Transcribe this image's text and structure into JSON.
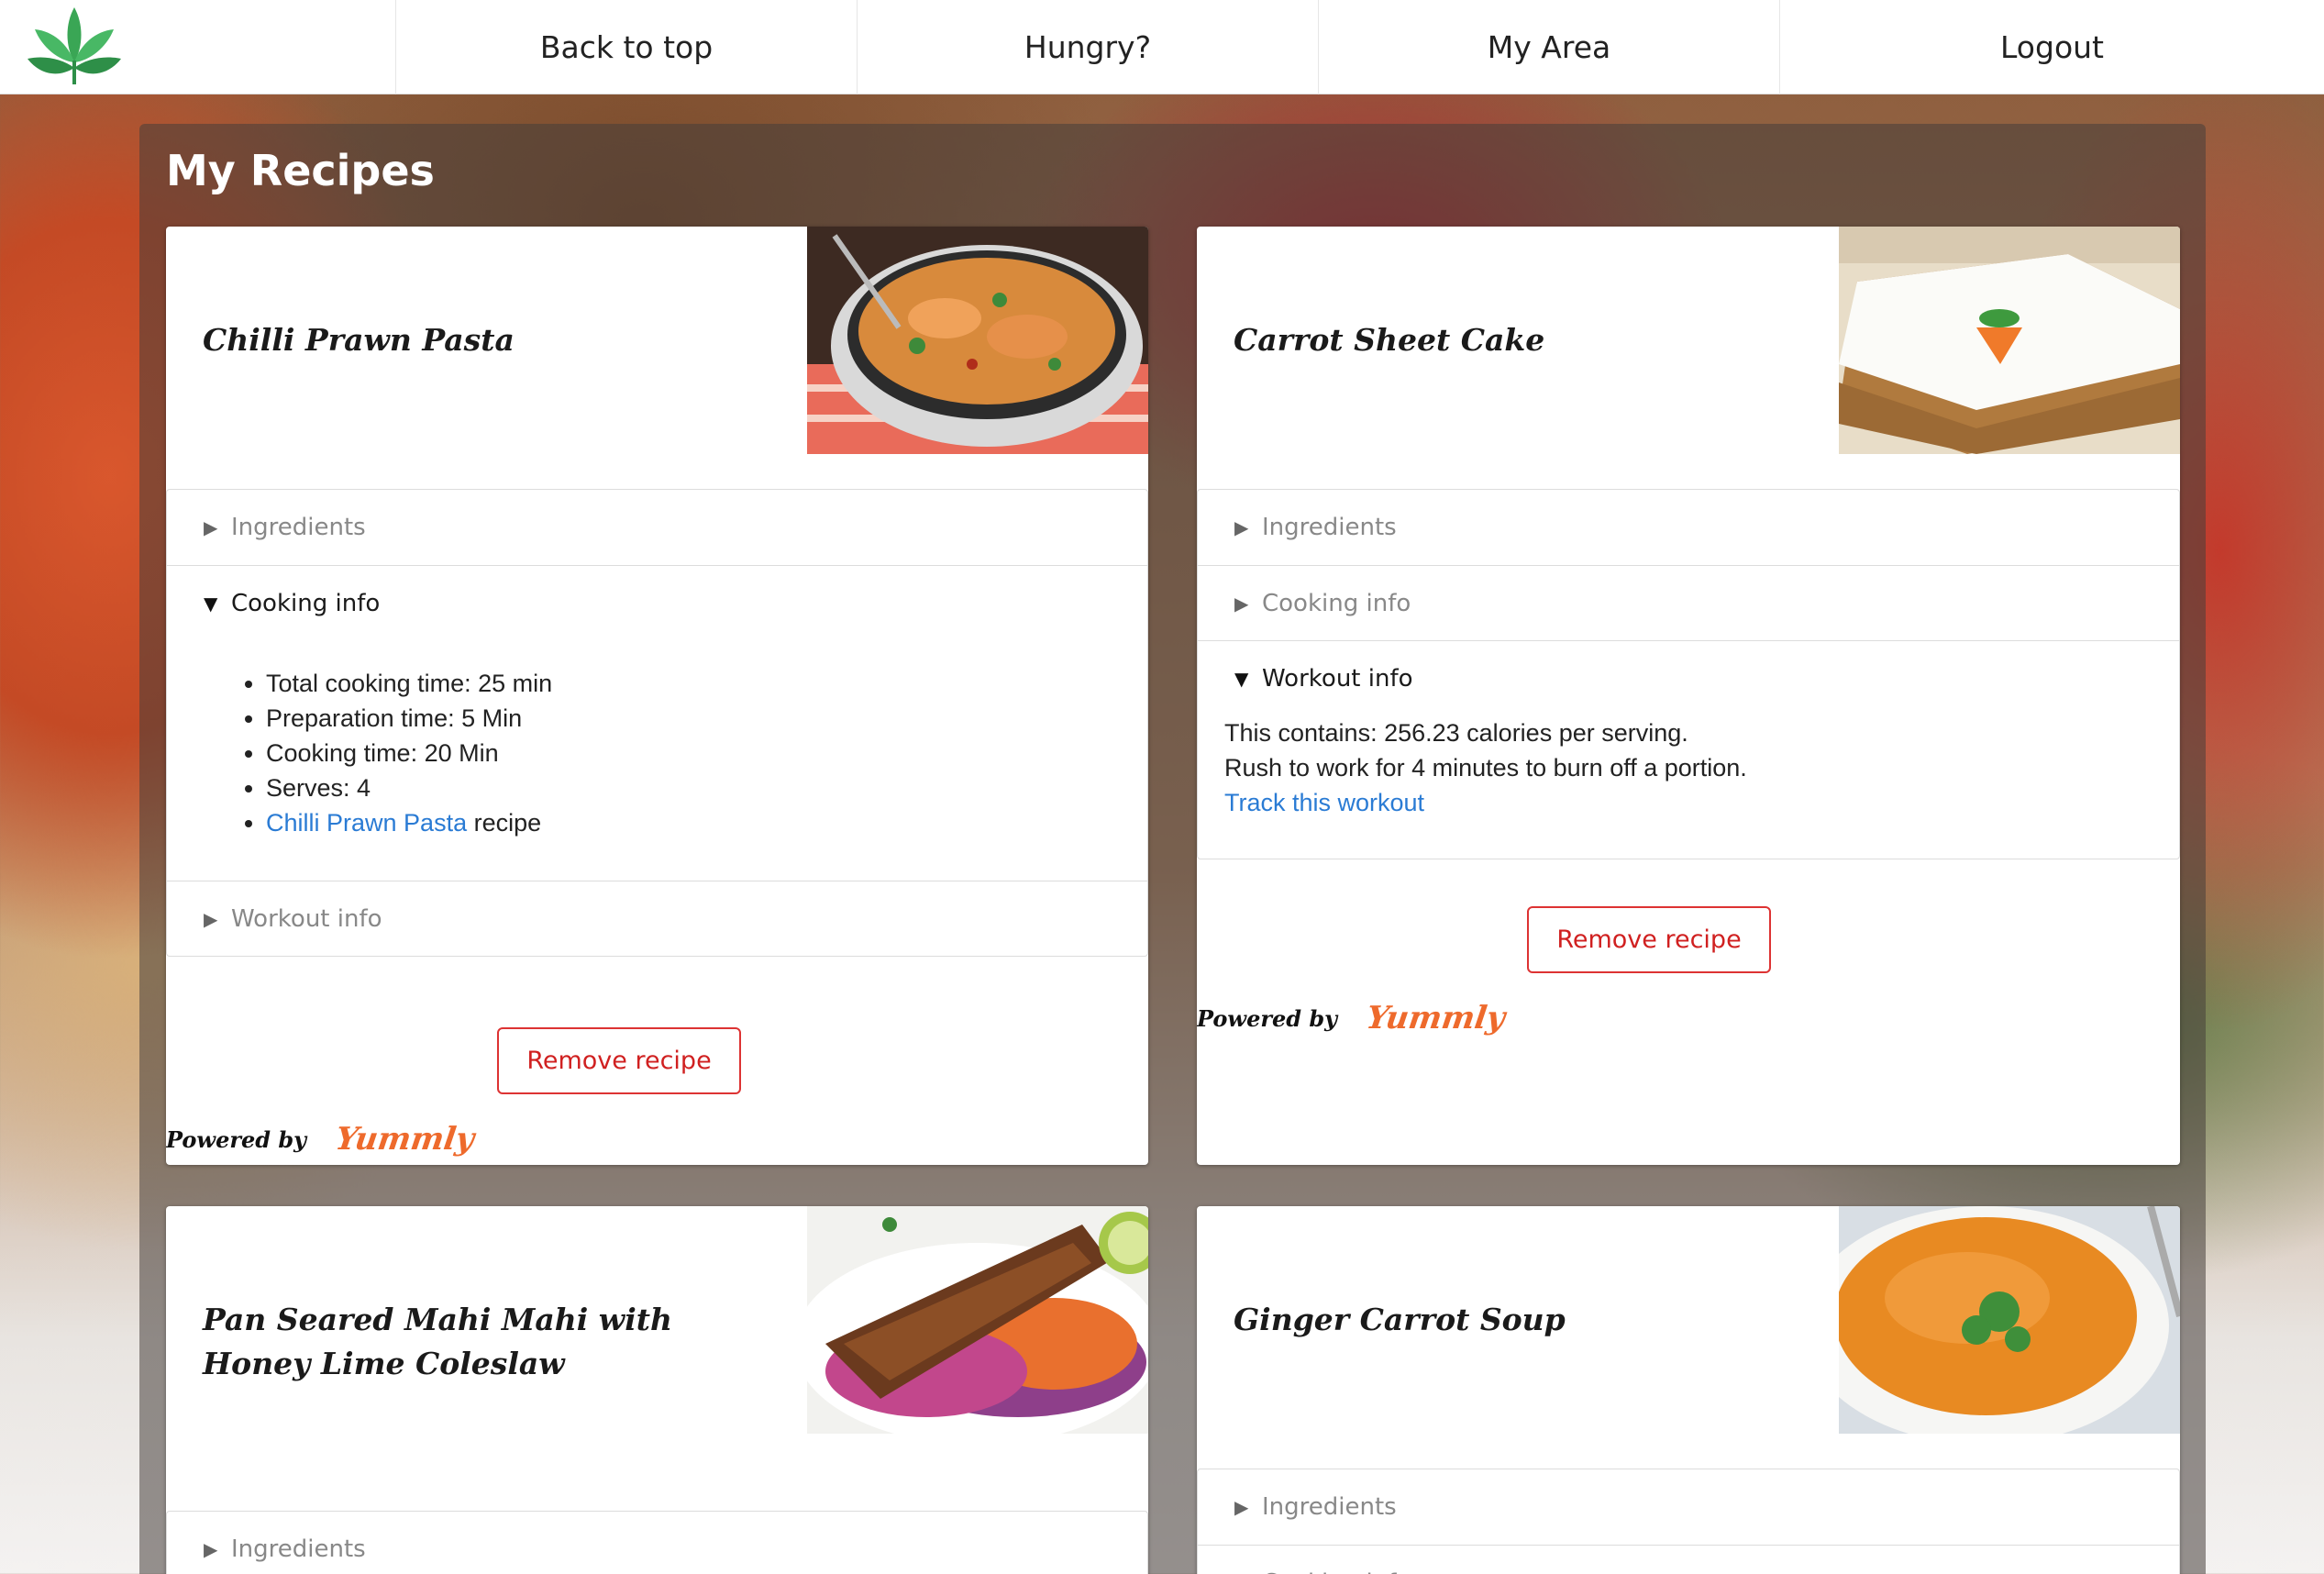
{
  "nav": {
    "back_to_top": "Back to top",
    "hungry": "Hungry?",
    "my_area": "My Area",
    "logout": "Logout"
  },
  "page": {
    "title": "My Recipes"
  },
  "accordion_labels": {
    "ingredients": "Ingredients",
    "cooking_info": "Cooking info",
    "workout_info": "Workout info"
  },
  "common": {
    "remove_label": "Remove recipe",
    "powered_by": "Powered by",
    "yummly": "Yummly"
  },
  "recipes": [
    {
      "title": "Chilli Prawn Pasta",
      "cooking": {
        "total": "Total cooking time: 25 min",
        "prep": "Preparation time: 5 Min",
        "cook": "Cooking time: 20 Min",
        "serves": "Serves: 4",
        "link_text": "Chilli Prawn Pasta",
        "link_suffix": " recipe"
      }
    },
    {
      "title": "Carrot Sheet Cake",
      "workout": {
        "calories": "This contains: 256.23 calories per serving.",
        "rush": "Rush to work for 4 minutes to burn off a portion.",
        "track": "Track this workout"
      }
    },
    {
      "title": "Pan Seared Mahi Mahi with Honey Lime Coleslaw"
    },
    {
      "title": "Ginger Carrot Soup"
    }
  ],
  "colors": {
    "accent_red": "#d02020",
    "link_blue": "#2a7bd4",
    "yummly_orange": "#ee6a2c",
    "logo_green": "#3aa655"
  }
}
